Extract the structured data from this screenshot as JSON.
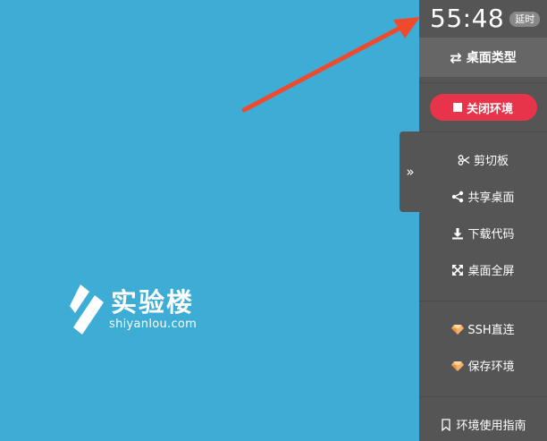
{
  "timer": {
    "time": "55:48",
    "delay_badge": "延时"
  },
  "panel": {
    "desktop_type": "桌面类型",
    "close_env": "关闭环境",
    "collapse_glyph": "»",
    "menu": [
      {
        "label": "剪切板",
        "icon": "scissors-icon"
      },
      {
        "label": "共享桌面",
        "icon": "share-icon"
      },
      {
        "label": "下载代码",
        "icon": "download-icon"
      },
      {
        "label": "桌面全屏",
        "icon": "fullscreen-icon"
      }
    ],
    "premium": [
      {
        "label": "SSH直连",
        "icon": "diamond-icon"
      },
      {
        "label": "保存环境",
        "icon": "diamond-icon"
      }
    ],
    "guide": "环境使用指南"
  },
  "logo": {
    "cn": "实验楼",
    "en": "shiyanlou.com"
  },
  "colors": {
    "desktop_bg": "#3dadd6",
    "panel_bg": "#555555",
    "close_btn": "#e8344a",
    "arrow": "#f04a2e"
  }
}
